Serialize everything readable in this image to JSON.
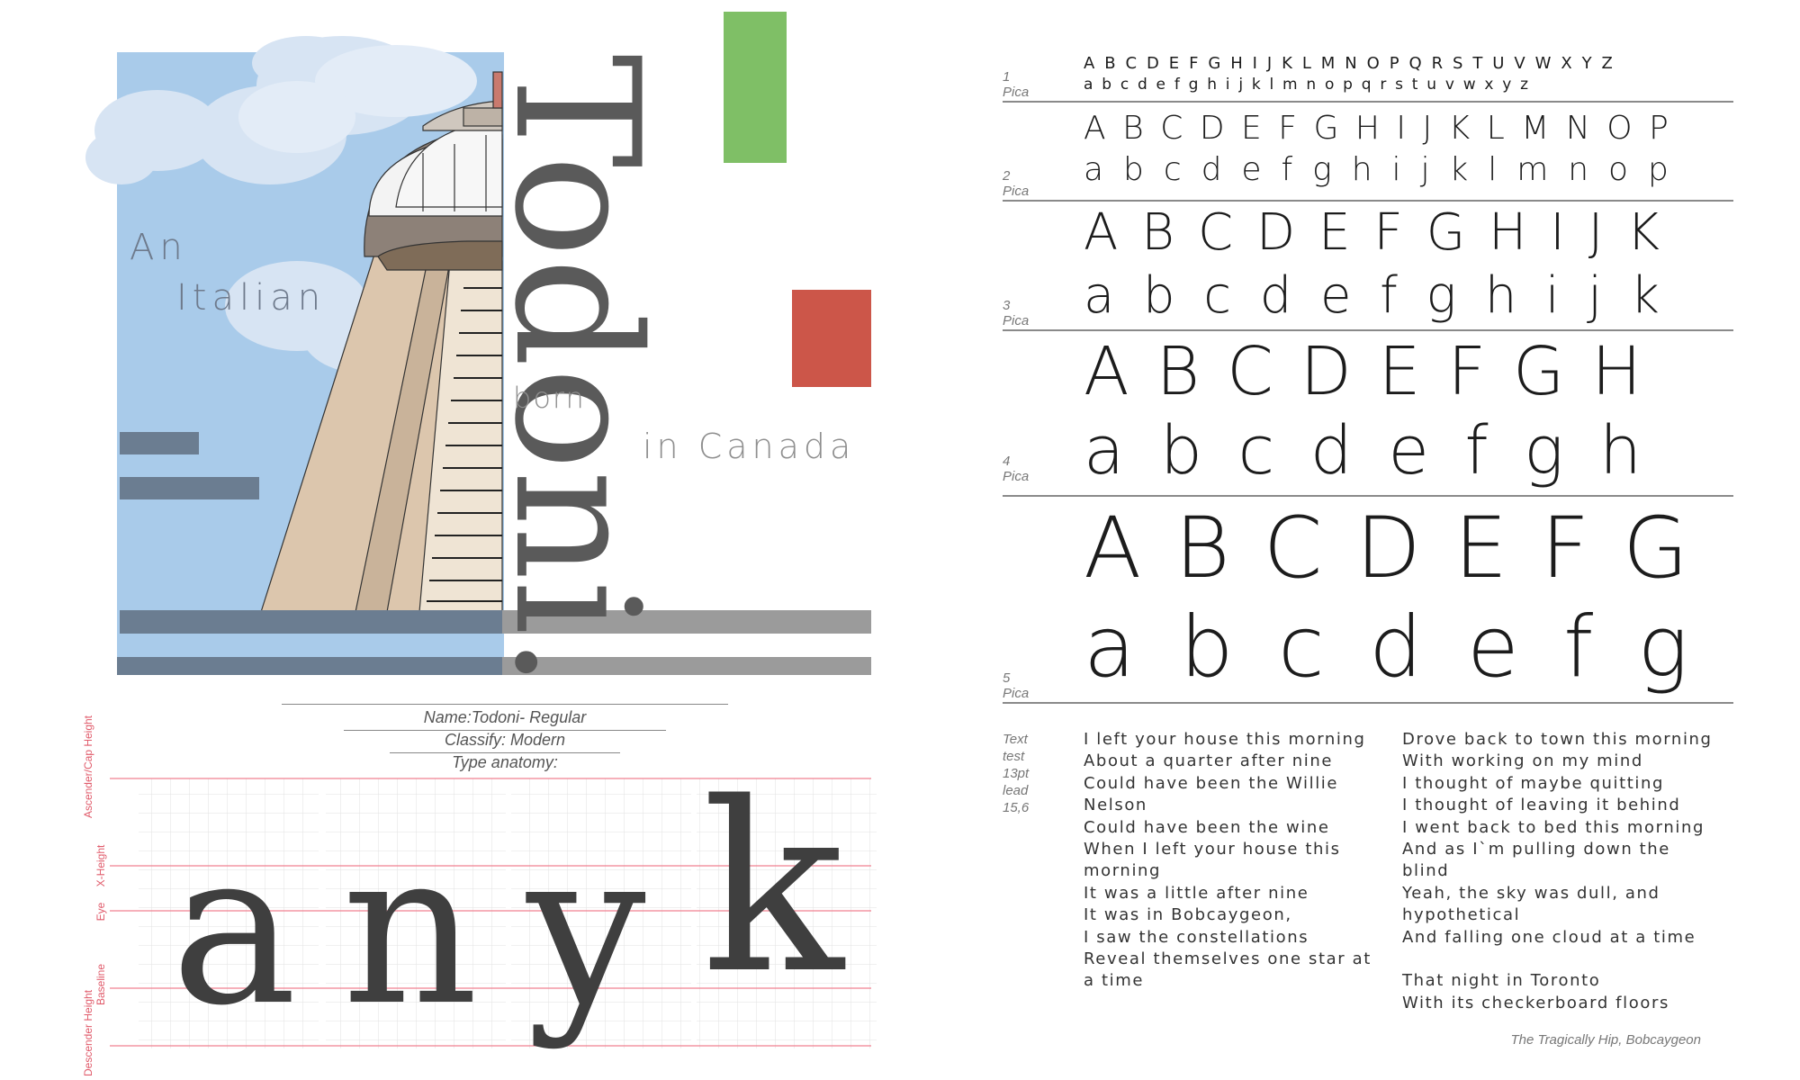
{
  "colors": {
    "sky": "#a9cbea",
    "accent_green": "#7fbf66",
    "accent_red": "#cc5649",
    "slate_bar": "#6b7d91",
    "gray_bar": "#9b9b9b",
    "guide_line": "#f08090",
    "grid": "#e2e2e2",
    "text_dark": "#333333"
  },
  "poster": {
    "title": "Todoni.",
    "tagline_an": "An",
    "tagline_italian": "Italian",
    "tagline_born": "born",
    "tagline_canada": "in Canada"
  },
  "info": {
    "name": "Name:Todoni- Regular",
    "classify": "Classify: Modern",
    "anatomy": "Type anatomy:"
  },
  "anatomy": {
    "glyphs": [
      "a",
      "n",
      "y",
      "k"
    ],
    "labels": {
      "ascender": "Ascender/Cap Height",
      "xheight": "X-Height",
      "eye": "Eye",
      "baseline": "Baseline",
      "descender": "Descender Height"
    }
  },
  "specimen": {
    "sizes": [
      {
        "label_num": "1",
        "label_unit": "Pica",
        "upper": "A B C D E F G H I J K L M N O P Q R S T U V W X Y Z",
        "lower": "a b c d e f g h i j k l m n o p q r s t u v w x y z"
      },
      {
        "label_num": "2",
        "label_unit": "Pica",
        "upper": [
          "A",
          "B",
          "C",
          "D",
          "E",
          "F",
          "G",
          "H",
          "I",
          "J",
          "K",
          "L",
          "M",
          "N",
          "O",
          "P"
        ],
        "lower": [
          "a",
          "b",
          "c",
          "d",
          "e",
          "f",
          "g",
          "h",
          "i",
          "j",
          "k",
          "l",
          "m",
          "n",
          "o",
          "p"
        ]
      },
      {
        "label_num": "3",
        "label_unit": "Pica",
        "upper": [
          "A",
          "B",
          "C",
          "D",
          "E",
          "F",
          "G",
          "H",
          "I",
          "J",
          "K"
        ],
        "lower": [
          "a",
          "b",
          "c",
          "d",
          "e",
          "f",
          "g",
          "h",
          "i",
          "j",
          "k"
        ]
      },
      {
        "label_num": "4",
        "label_unit": "Pica",
        "upper": [
          "A",
          "B",
          "C",
          "D",
          "E",
          "F",
          "G",
          "H"
        ],
        "lower": [
          "a",
          "b",
          "c",
          "d",
          "e",
          "f",
          "g",
          "h"
        ]
      },
      {
        "label_num": "5",
        "label_unit": "Pica",
        "upper": [
          "A",
          "B",
          "C",
          "D",
          "E",
          "F",
          "G"
        ],
        "lower": [
          "a",
          "b",
          "c",
          "d",
          "e",
          "f",
          "g"
        ]
      }
    ]
  },
  "text_test": {
    "meta": [
      "Text",
      "test",
      "13pt",
      "lead",
      "15,6"
    ],
    "col1": [
      "I left your house this morning",
      "About a quarter after nine",
      "Could have been the Willie",
      "Nelson",
      "Could have been the wine",
      "When I left your house this",
      "morning",
      "It was a little after nine",
      "It was in Bobcaygeon,",
      "I saw the constellations",
      "Reveal themselves one star at",
      "a time"
    ],
    "col2": [
      "Drove back to town this morning",
      "With working on my mind",
      "I thought of maybe quitting",
      "I thought of leaving it behind",
      "I went back to bed this morning",
      "And as I`m pulling down the",
      "blind",
      "Yeah, the sky was dull, and",
      "hypothetical",
      "And falling one cloud at a time",
      "",
      "That night in Toronto",
      "With its checkerboard floors"
    ],
    "credit": "The Tragically Hip, Bobcaygeon"
  }
}
